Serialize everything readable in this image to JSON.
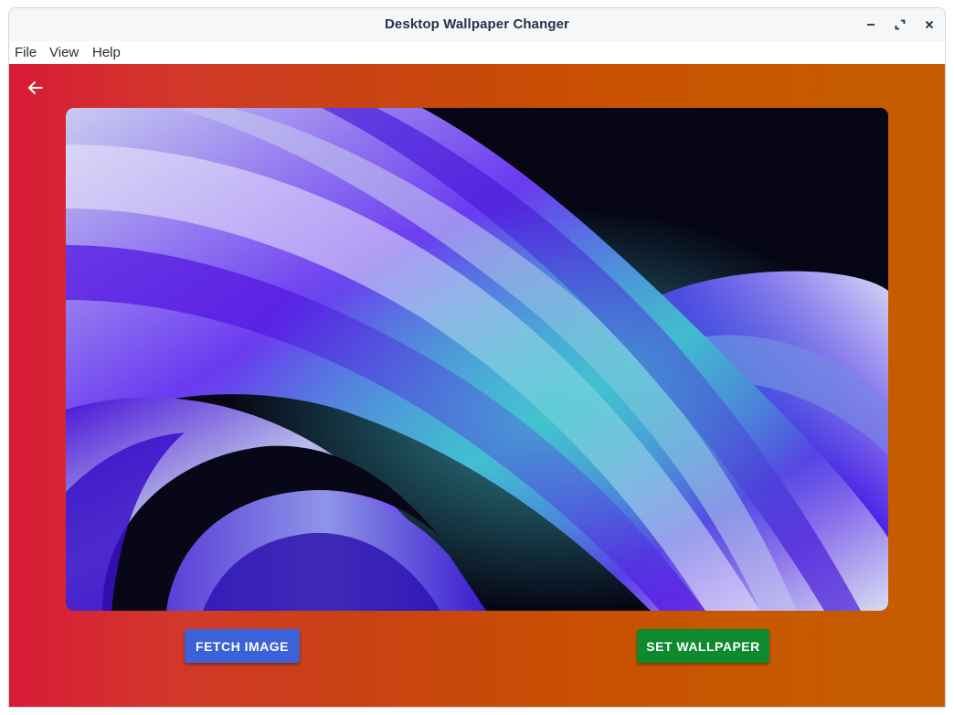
{
  "window": {
    "title": "Desktop Wallpaper Changer",
    "controls": [
      "minimize-icon",
      "maximize-icon",
      "close-icon"
    ]
  },
  "menubar": {
    "items": [
      {
        "label": "File"
      },
      {
        "label": "View"
      },
      {
        "label": "Help"
      }
    ]
  },
  "content": {
    "back_icon": "arrow-left-icon",
    "preview_image": "abstract purple and blue swirl wallpaper",
    "buttons": {
      "fetch_label": "FETCH IMAGE",
      "set_label": "SET WALLPAPER"
    }
  },
  "colors": {
    "gradient_start": "#d81a38",
    "gradient_end": "#c65c00",
    "fetch_button": "#3b62d9",
    "set_button": "#0e8a2e"
  }
}
